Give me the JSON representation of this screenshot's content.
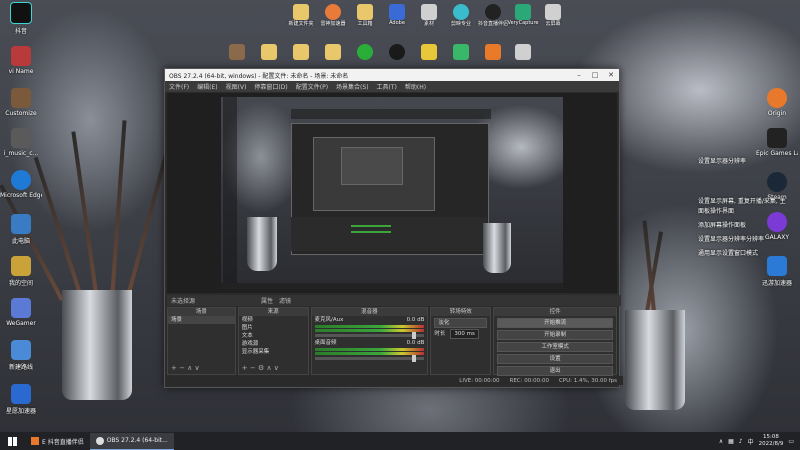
{
  "desktop": {
    "left_icons": [
      {
        "label": "抖音",
        "color": "#111111"
      },
      {
        "label": "vi Name",
        "color": "#b83a3a"
      },
      {
        "label": "Customize",
        "color": "#7a5a3a"
      },
      {
        "label": "i_music_c...",
        "color": "#5a5a5a"
      },
      {
        "label": "Microsoft Edge",
        "color": "#1f7ad6"
      },
      {
        "label": "此电脑",
        "color": "#3a7cc4"
      },
      {
        "label": "我的空间",
        "color": "#c9a23a"
      },
      {
        "label": "WeGamer",
        "color": "#5a7ad6"
      },
      {
        "label": "新建路线",
        "color": "#4a8ad6"
      },
      {
        "label": "星愿加速器",
        "color": "#2a6ad0"
      }
    ],
    "top_icons": [
      {
        "label": "新建文件夹",
        "color": "#e8c86a"
      },
      {
        "label": "雷神加速器",
        "color": "#e87a3a"
      },
      {
        "label": "工具箱",
        "color": "#e8c86a"
      },
      {
        "label": "Adobe",
        "color": "#3a6ad6"
      },
      {
        "label": "素材",
        "color": "#d0d0d0"
      },
      {
        "label": "剪映专业",
        "color": "#3abccc"
      },
      {
        "label": "抖音直播伴侣",
        "color": "#222222"
      },
      {
        "label": "VeryCapture",
        "color": "#2aa878"
      },
      {
        "label": "云屏幕",
        "color": "#d0d0d0"
      }
    ],
    "right_icons": [
      {
        "label": "Origin",
        "color": "#e8792c"
      },
      {
        "label": "Epic Games Launcher",
        "color": "#222222"
      },
      {
        "label": "Steam",
        "color": "#1b2838"
      },
      {
        "label": "GALAXY",
        "color": "#7b3ad6"
      },
      {
        "label": "迅游加速器",
        "color": "#2a7ad6"
      }
    ],
    "notes": [
      "设置显示器分辨率",
      "设置显示屏幕, 重复开播/采集, 主",
      "面板操作界面",
      "添加屏幕操作面板",
      "设置显示器分辨率分辨率",
      "通用显示设置窗口模式"
    ]
  },
  "obs": {
    "title": "OBS 27.2.4 (64-bit, windows) - 配置文件: 未命名 - 场景: 未命名",
    "menu": [
      "文件(F)",
      "编辑(E)",
      "视图(V)",
      "停靠窗口(D)",
      "配置文件(P)",
      "场景集合(S)",
      "工具(T)",
      "帮助(H)"
    ],
    "scene_label": "未选择源",
    "scene_tabs": [
      "属性",
      "滤镜"
    ],
    "docks": {
      "scenes": {
        "title": "场景",
        "items": [
          "场景"
        ]
      },
      "sources": {
        "title": "来源",
        "items": [
          "视频",
          "图片",
          "文本",
          "游戏源",
          "显示器采集"
        ]
      },
      "mixer": {
        "title": "混音器",
        "channels": [
          {
            "name": "麦克风/Aux",
            "db": "0.0 dB"
          },
          {
            "name": "桌面音频",
            "db": "0.0 dB"
          }
        ]
      },
      "transitions": {
        "title": "转场特效",
        "type": "淡化",
        "duration_label": "时长",
        "duration": "300 ms"
      },
      "controls": {
        "title": "控件",
        "buttons": [
          "开始推流",
          "开始录制",
          "启动虚拟摄像机",
          "工作室模式",
          "设置",
          "退出"
        ]
      }
    },
    "status": {
      "live_label": "LIVE:",
      "live": "00:00:00",
      "rec_label": "REC:",
      "rec": "00:00:00",
      "cpu": "CPU: 1.4%, 30.00 fps"
    }
  },
  "taskbar": {
    "tasks": [
      {
        "label": "E 抖音直播伴侣",
        "active": false
      },
      {
        "label": "OBS 27.2.4 (64-bit...",
        "active": true
      }
    ],
    "time": "15:08",
    "date": "2022/8/9",
    "lang": "中"
  }
}
